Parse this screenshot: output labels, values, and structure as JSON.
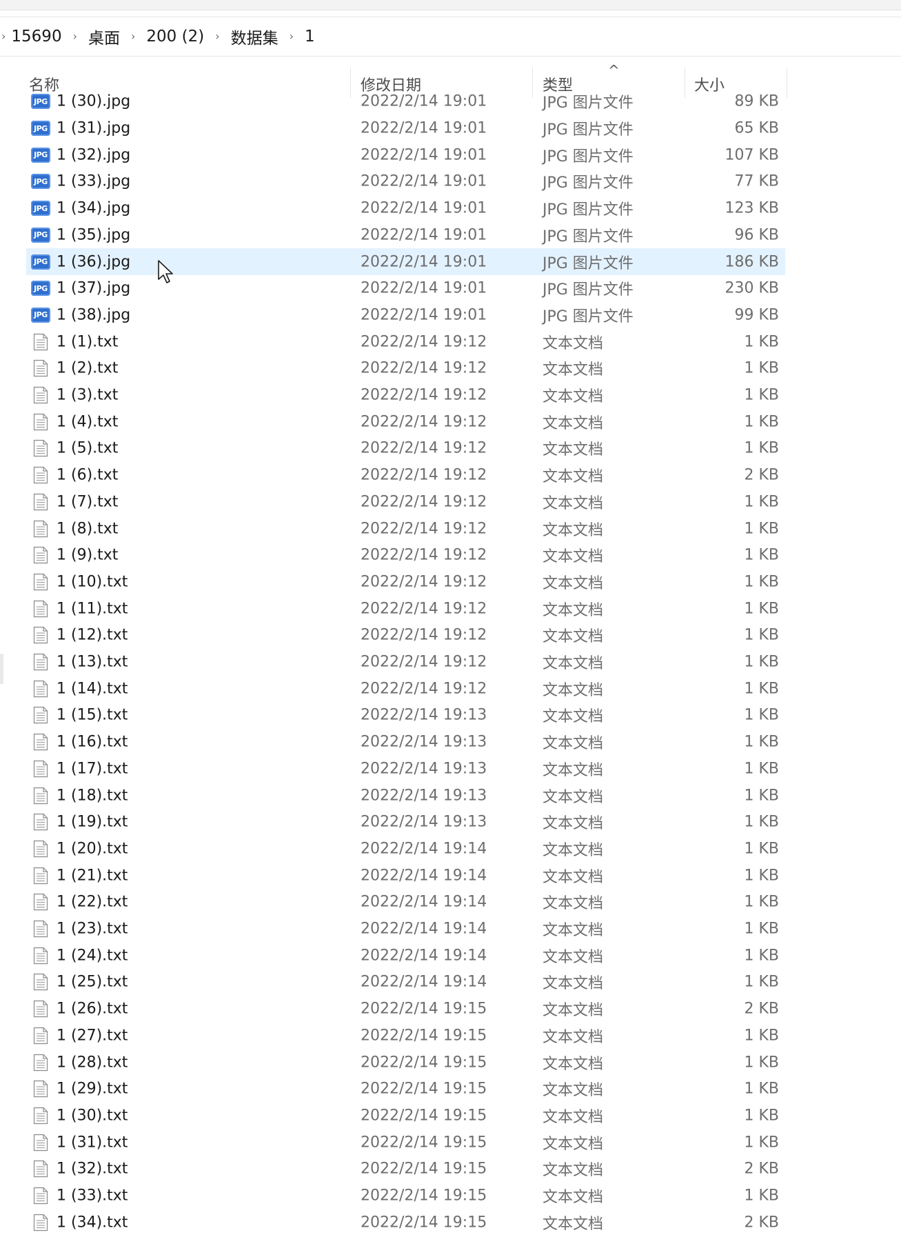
{
  "breadcrumb": {
    "items": [
      "15690",
      "桌面",
      "200 (2)",
      "数据集",
      "1"
    ]
  },
  "columns": {
    "name": "名称",
    "date": "修改日期",
    "type": "类型",
    "size": "大小",
    "sort_indicator": "^"
  },
  "selected_row_index": 6,
  "files": [
    {
      "name": "1 (30).jpg",
      "date": "2022/2/14 19:01",
      "type": "JPG 图片文件",
      "size": "89 KB",
      "kind": "jpg"
    },
    {
      "name": "1 (31).jpg",
      "date": "2022/2/14 19:01",
      "type": "JPG 图片文件",
      "size": "65 KB",
      "kind": "jpg"
    },
    {
      "name": "1 (32).jpg",
      "date": "2022/2/14 19:01",
      "type": "JPG 图片文件",
      "size": "107 KB",
      "kind": "jpg"
    },
    {
      "name": "1 (33).jpg",
      "date": "2022/2/14 19:01",
      "type": "JPG 图片文件",
      "size": "77 KB",
      "kind": "jpg"
    },
    {
      "name": "1 (34).jpg",
      "date": "2022/2/14 19:01",
      "type": "JPG 图片文件",
      "size": "123 KB",
      "kind": "jpg"
    },
    {
      "name": "1 (35).jpg",
      "date": "2022/2/14 19:01",
      "type": "JPG 图片文件",
      "size": "96 KB",
      "kind": "jpg"
    },
    {
      "name": "1 (36).jpg",
      "date": "2022/2/14 19:01",
      "type": "JPG 图片文件",
      "size": "186 KB",
      "kind": "jpg"
    },
    {
      "name": "1 (37).jpg",
      "date": "2022/2/14 19:01",
      "type": "JPG 图片文件",
      "size": "230 KB",
      "kind": "jpg"
    },
    {
      "name": "1 (38).jpg",
      "date": "2022/2/14 19:01",
      "type": "JPG 图片文件",
      "size": "99 KB",
      "kind": "jpg"
    },
    {
      "name": "1 (1).txt",
      "date": "2022/2/14 19:12",
      "type": "文本文档",
      "size": "1 KB",
      "kind": "txt"
    },
    {
      "name": "1 (2).txt",
      "date": "2022/2/14 19:12",
      "type": "文本文档",
      "size": "1 KB",
      "kind": "txt"
    },
    {
      "name": "1 (3).txt",
      "date": "2022/2/14 19:12",
      "type": "文本文档",
      "size": "1 KB",
      "kind": "txt"
    },
    {
      "name": "1 (4).txt",
      "date": "2022/2/14 19:12",
      "type": "文本文档",
      "size": "1 KB",
      "kind": "txt"
    },
    {
      "name": "1 (5).txt",
      "date": "2022/2/14 19:12",
      "type": "文本文档",
      "size": "1 KB",
      "kind": "txt"
    },
    {
      "name": "1 (6).txt",
      "date": "2022/2/14 19:12",
      "type": "文本文档",
      "size": "2 KB",
      "kind": "txt"
    },
    {
      "name": "1 (7).txt",
      "date": "2022/2/14 19:12",
      "type": "文本文档",
      "size": "1 KB",
      "kind": "txt"
    },
    {
      "name": "1 (8).txt",
      "date": "2022/2/14 19:12",
      "type": "文本文档",
      "size": "1 KB",
      "kind": "txt"
    },
    {
      "name": "1 (9).txt",
      "date": "2022/2/14 19:12",
      "type": "文本文档",
      "size": "1 KB",
      "kind": "txt"
    },
    {
      "name": "1 (10).txt",
      "date": "2022/2/14 19:12",
      "type": "文本文档",
      "size": "1 KB",
      "kind": "txt"
    },
    {
      "name": "1 (11).txt",
      "date": "2022/2/14 19:12",
      "type": "文本文档",
      "size": "1 KB",
      "kind": "txt"
    },
    {
      "name": "1 (12).txt",
      "date": "2022/2/14 19:12",
      "type": "文本文档",
      "size": "1 KB",
      "kind": "txt"
    },
    {
      "name": "1 (13).txt",
      "date": "2022/2/14 19:12",
      "type": "文本文档",
      "size": "1 KB",
      "kind": "txt"
    },
    {
      "name": "1 (14).txt",
      "date": "2022/2/14 19:12",
      "type": "文本文档",
      "size": "1 KB",
      "kind": "txt"
    },
    {
      "name": "1 (15).txt",
      "date": "2022/2/14 19:13",
      "type": "文本文档",
      "size": "1 KB",
      "kind": "txt"
    },
    {
      "name": "1 (16).txt",
      "date": "2022/2/14 19:13",
      "type": "文本文档",
      "size": "1 KB",
      "kind": "txt"
    },
    {
      "name": "1 (17).txt",
      "date": "2022/2/14 19:13",
      "type": "文本文档",
      "size": "1 KB",
      "kind": "txt"
    },
    {
      "name": "1 (18).txt",
      "date": "2022/2/14 19:13",
      "type": "文本文档",
      "size": "1 KB",
      "kind": "txt"
    },
    {
      "name": "1 (19).txt",
      "date": "2022/2/14 19:13",
      "type": "文本文档",
      "size": "1 KB",
      "kind": "txt"
    },
    {
      "name": "1 (20).txt",
      "date": "2022/2/14 19:14",
      "type": "文本文档",
      "size": "1 KB",
      "kind": "txt"
    },
    {
      "name": "1 (21).txt",
      "date": "2022/2/14 19:14",
      "type": "文本文档",
      "size": "1 KB",
      "kind": "txt"
    },
    {
      "name": "1 (22).txt",
      "date": "2022/2/14 19:14",
      "type": "文本文档",
      "size": "1 KB",
      "kind": "txt"
    },
    {
      "name": "1 (23).txt",
      "date": "2022/2/14 19:14",
      "type": "文本文档",
      "size": "1 KB",
      "kind": "txt"
    },
    {
      "name": "1 (24).txt",
      "date": "2022/2/14 19:14",
      "type": "文本文档",
      "size": "1 KB",
      "kind": "txt"
    },
    {
      "name": "1 (25).txt",
      "date": "2022/2/14 19:14",
      "type": "文本文档",
      "size": "1 KB",
      "kind": "txt"
    },
    {
      "name": "1 (26).txt",
      "date": "2022/2/14 19:15",
      "type": "文本文档",
      "size": "2 KB",
      "kind": "txt"
    },
    {
      "name": "1 (27).txt",
      "date": "2022/2/14 19:15",
      "type": "文本文档",
      "size": "1 KB",
      "kind": "txt"
    },
    {
      "name": "1 (28).txt",
      "date": "2022/2/14 19:15",
      "type": "文本文档",
      "size": "1 KB",
      "kind": "txt"
    },
    {
      "name": "1 (29).txt",
      "date": "2022/2/14 19:15",
      "type": "文本文档",
      "size": "1 KB",
      "kind": "txt"
    },
    {
      "name": "1 (30).txt",
      "date": "2022/2/14 19:15",
      "type": "文本文档",
      "size": "1 KB",
      "kind": "txt"
    },
    {
      "name": "1 (31).txt",
      "date": "2022/2/14 19:15",
      "type": "文本文档",
      "size": "1 KB",
      "kind": "txt"
    },
    {
      "name": "1 (32).txt",
      "date": "2022/2/14 19:15",
      "type": "文本文档",
      "size": "2 KB",
      "kind": "txt"
    },
    {
      "name": "1 (33).txt",
      "date": "2022/2/14 19:15",
      "type": "文本文档",
      "size": "1 KB",
      "kind": "txt"
    },
    {
      "name": "1 (34).txt",
      "date": "2022/2/14 19:15",
      "type": "文本文档",
      "size": "2 KB",
      "kind": "txt"
    }
  ]
}
